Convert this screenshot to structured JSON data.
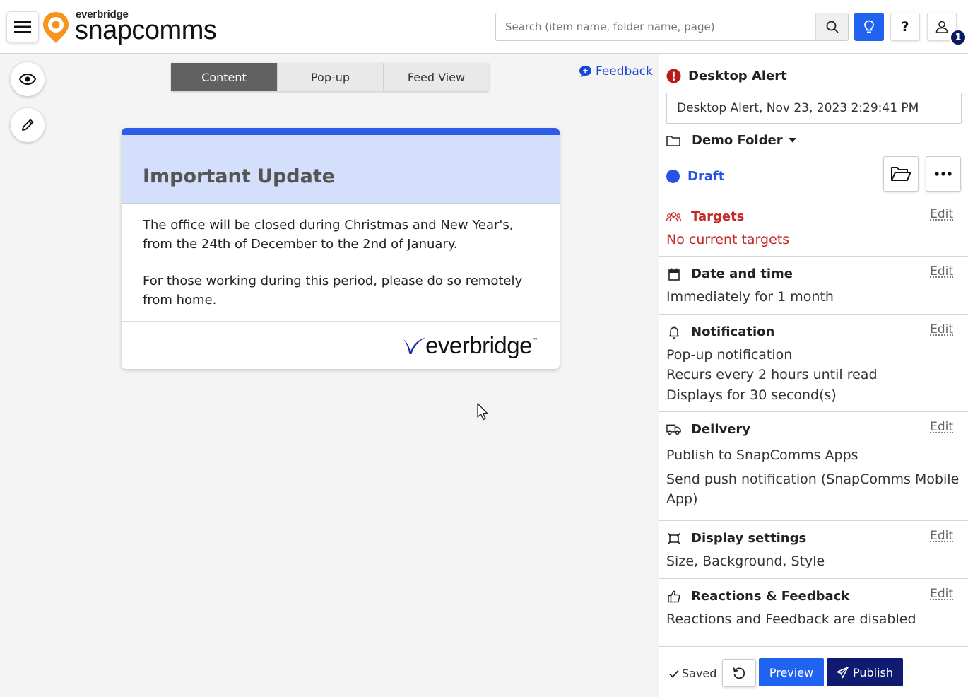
{
  "header": {
    "brand": "everbridge",
    "product": "snapcomms",
    "search_placeholder": "Search (item name, folder name, page)",
    "help_label": "?",
    "notification_count": "1"
  },
  "tabs": [
    {
      "label": "Content",
      "active": true
    },
    {
      "label": "Pop-up",
      "active": false
    },
    {
      "label": "Feed View",
      "active": false
    }
  ],
  "feedback_link": "Feedback",
  "alert": {
    "title": "Important Update",
    "paragraphs": [
      "The office will be closed during Christmas and New Year's, from the 24th of December to the 2nd of January.",
      "For those working during this period, please do so remotely from home."
    ],
    "footer_logo": "everbridge"
  },
  "panel": {
    "type_title": "Desktop Alert",
    "name_value": "Desktop Alert, Nov 23, 2023 2:29:41 PM",
    "folder": "Demo Folder",
    "status": "Draft",
    "sections": {
      "targets": {
        "title": "Targets",
        "edit": "Edit",
        "lines": [
          "No current targets"
        ]
      },
      "datetime": {
        "title": "Date and time",
        "edit": "Edit",
        "lines": [
          "Immediately for 1 month"
        ]
      },
      "notification": {
        "title": "Notification",
        "edit": "Edit",
        "lines": [
          "Pop-up notification",
          "Recurs every 2 hours until read",
          "Displays for 30 second(s)"
        ]
      },
      "delivery": {
        "title": "Delivery",
        "edit": "Edit",
        "lines": [
          "Publish to SnapComms Apps",
          "Send push notification (SnapComms Mobile",
          "App)"
        ]
      },
      "display": {
        "title": "Display settings",
        "edit": "Edit",
        "lines": [
          "Size, Background, Style"
        ]
      },
      "reactions": {
        "title": "Reactions & Feedback",
        "edit": "Edit",
        "lines": [
          "Reactions and Feedback are disabled"
        ]
      }
    },
    "footer": {
      "saved": "Saved",
      "preview": "Preview",
      "publish": "Publish"
    }
  },
  "colors": {
    "primary": "#1f63f0",
    "publish": "#0f1b70",
    "draft": "#2751e6",
    "alert_header": "#d3dffb",
    "alert_topbar": "#2f5ce6",
    "error": "#c62828",
    "logo_orange": "#f7941d"
  }
}
